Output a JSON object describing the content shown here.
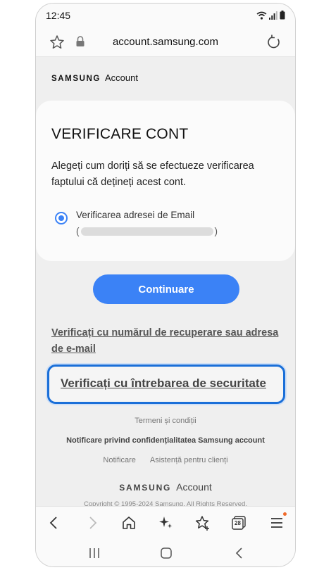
{
  "status_bar": {
    "time": "12:45"
  },
  "address_bar": {
    "url": "account.samsung.com"
  },
  "page": {
    "brand_wordmark": "SAMSUNG",
    "brand_account": "Account",
    "card": {
      "title": "VERIFICARE CONT",
      "description": "Alegeți cum doriți să se efectueze verificarea faptului că dețineți acest cont.",
      "option_label": "Verificarea adresei de Email",
      "option_selected": true,
      "masked_open": "(",
      "masked_close": ")"
    },
    "continue_label": "Continuare",
    "link_recovery": "Verificați cu numărul de recuperare sau adresa de e-mail",
    "link_security": "Verificați cu întrebarea de securitate",
    "footer": {
      "terms": "Termeni și condiții",
      "privacy": "Notificare privind confidențialitatea Samsung account",
      "notice": "Notificare",
      "support": "Asistență pentru clienți",
      "brand_wordmark": "SAMSUNG",
      "brand_account": "Account",
      "copyright": "Copyright © 1995-2024 Samsung. All Rights Reserved."
    }
  },
  "browser_toolbar": {
    "tabs_count": "28"
  },
  "colors": {
    "accent": "#3b82f6",
    "highlight_border": "#1a6fd8",
    "notification_dot": "#f06a2a"
  }
}
